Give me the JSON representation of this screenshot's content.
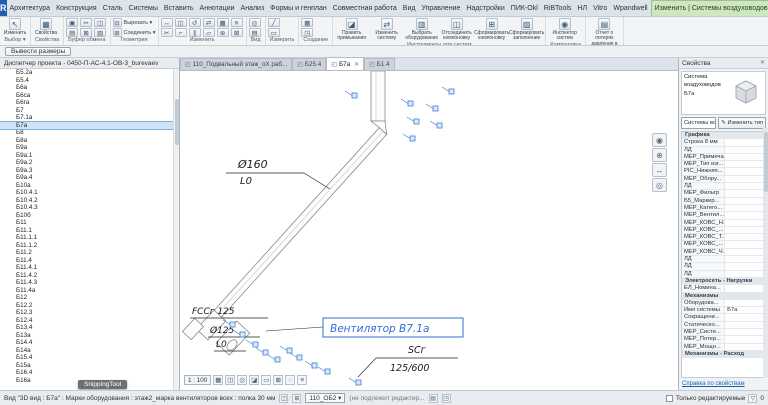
{
  "app": {
    "file_button": "R",
    "tabs": [
      "Архитектура",
      "Конструкция",
      "Сталь",
      "Системы",
      "Вставить",
      "Аннотации",
      "Анализ",
      "Формы и генплан",
      "Совместная работа",
      "Вид",
      "Управление",
      "Надстройки",
      "ПИК-Okl",
      "RiBTools",
      "НЛ",
      "Vitro",
      "Wpandwell"
    ],
    "context_tab": "Изменить | Системы воздуховодов",
    "ribbon_toggle_icon": "▾",
    "help_icon": "?"
  },
  "ribbon": {
    "options_button": "Вывести размеры",
    "groups": [
      {
        "label": "Выбор ▾",
        "type": "big",
        "buttons": [
          {
            "name": "modify-tool-button",
            "icon": "↖",
            "label": "Изменить"
          }
        ]
      },
      {
        "label": "Свойства",
        "type": "big",
        "buttons": [
          {
            "name": "properties-toggle-button",
            "icon": "▦",
            "label": "Свойства"
          }
        ]
      },
      {
        "label": "Буфер обмена",
        "type": "grid",
        "icons": [
          {
            "name": "paste-icon",
            "g": "▣"
          },
          {
            "name": "cut-icon",
            "g": "✂"
          },
          {
            "name": "copy-icon",
            "g": "◫"
          },
          {
            "name": "match-type-icon",
            "g": "▤"
          },
          {
            "name": "delete-icon",
            "g": "⊠"
          },
          {
            "name": "paint-icon",
            "g": "▧"
          }
        ]
      },
      {
        "label": "Геометрия",
        "type": "rows",
        "rows": [
          {
            "name": "cut-geometry-button",
            "icon": "⊟",
            "label": "Вырезать ▾"
          },
          {
            "name": "join-geometry-button",
            "icon": "⊞",
            "label": "Соединить ▾"
          }
        ]
      },
      {
        "label": "Изменить",
        "type": "grid",
        "icons": [
          {
            "name": "move-icon",
            "g": "↔"
          },
          {
            "name": "copy-element-icon",
            "g": "◫"
          },
          {
            "name": "rotate-icon",
            "g": "↺"
          },
          {
            "name": "mirror-icon",
            "g": "⇄"
          },
          {
            "name": "array-icon",
            "g": "▦"
          },
          {
            "name": "align-icon",
            "g": "≡"
          },
          {
            "name": "split-icon",
            "g": "✂"
          },
          {
            "name": "trim-icon",
            "g": "⌐"
          },
          {
            "name": "offset-icon",
            "g": "∥"
          },
          {
            "name": "scale-icon",
            "g": "▱"
          },
          {
            "name": "pin-icon",
            "g": "⊕"
          },
          {
            "name": "delete-element-icon",
            "g": "⊠"
          }
        ]
      },
      {
        "label": "Вид",
        "type": "grid",
        "icons": [
          {
            "name": "hide-element-icon",
            "g": "◎"
          },
          {
            "name": "visibility-icon",
            "g": "▤"
          }
        ]
      },
      {
        "label": "Измерить",
        "type": "grid",
        "icons": [
          {
            "name": "measure-icon",
            "g": "╱"
          },
          {
            "name": "dimension-icon",
            "g": "▭"
          }
        ]
      },
      {
        "label": "Создание",
        "type": "grid",
        "icons": [
          {
            "name": "create-group-icon",
            "g": "▦"
          },
          {
            "name": "create-similar-icon",
            "g": "◳"
          }
        ]
      },
      {
        "label": "Инструменты для систем",
        "type": "bigrow",
        "buttons": [
          {
            "name": "edit-adjoining-button",
            "icon": "◪",
            "label": "Править примыкания"
          },
          {
            "name": "edit-system-button",
            "icon": "⇄",
            "label": "Изменить систему"
          },
          {
            "name": "select-equipment-button",
            "icon": "▥",
            "label": "Выбрать оборудование"
          },
          {
            "name": "disconnect-layout-button",
            "icon": "◫",
            "label": "Отсоединить компоновку"
          },
          {
            "name": "generate-layout-button",
            "icon": "⊞",
            "label": "Сформировать компоновку"
          },
          {
            "name": "generate-placeholder-button",
            "icon": "▨",
            "label": "Сформировать заполнение"
          }
        ]
      },
      {
        "label": "Компоновка",
        "type": "bigrow",
        "buttons": [
          {
            "name": "system-inspector-button",
            "icon": "◉",
            "label": "Инспектор систем"
          }
        ]
      },
      {
        "label": "Анализ",
        "type": "bigrow",
        "buttons": [
          {
            "name": "pressure-loss-report-button",
            "icon": "▤",
            "label": "Отчет о потерях давления в воздуховоде"
          }
        ]
      }
    ]
  },
  "browser": {
    "title": "Диспетчер проекта - 0450-П-АС-4.1-ОВ-3_burevaev",
    "selected_index": 7,
    "items": [
      "Б5.2а",
      "Б5.4",
      "Б6а",
      "Б6са",
      "Б6га",
      "Б7",
      "Б7.1а",
      "Б7а",
      "Б8",
      "Б8а",
      "Б9а",
      "Б9а.1",
      "Б9а.2",
      "Б9а.3",
      "Б9а.4",
      "Б10а",
      "Б10.4.1",
      "Б10.4.2",
      "Б10.4.3",
      "Б10б",
      "Б11",
      "Б11.1",
      "Б11.1.1",
      "Б11.1.2",
      "Б11.2",
      "Б11.4",
      "Б11.4.1",
      "Б11.4.2",
      "Б11.4.3",
      "Б11.4а",
      "Б12",
      "Б12.2",
      "Б12.3",
      "Б12.4",
      "Б13.4",
      "Б13а",
      "Б14.4",
      "Б14а",
      "Б15.4",
      "Б15а",
      "Б16.4",
      "Б16а"
    ]
  },
  "view_tabs": [
    {
      "label": "110_Подвальный этаж_оХ раб...",
      "active": false
    },
    {
      "label": "Б25.4",
      "active": false
    },
    {
      "label": "Б7а",
      "active": true
    },
    {
      "label": "Б1.4",
      "active": false
    }
  ],
  "canvas": {
    "scale": "1 : 100",
    "labels": {
      "duct_dia": "Ø160",
      "duct_len": "L0",
      "fan_model": "FCCг 125",
      "fan_dia": "Ø125",
      "fan_len": "L0",
      "fan_name": "Вентилятор В7.1а",
      "grille_code": "SCг",
      "grille_size": "125/600"
    }
  },
  "properties": {
    "title": "Свойства",
    "type_family": "Система воздуховодов",
    "type_name": "Б7а",
    "selector_value": "Системы возду...",
    "edit_type_label": "Изменить тип",
    "help_link": "Справка по свойствам",
    "rows": [
      {
        "cat": "Графика"
      },
      {
        "name": "Строка 8 мм",
        "value": ""
      },
      {
        "name": "ЛД",
        "value": ""
      },
      {
        "name": "MEP_Примеча...",
        "value": ""
      },
      {
        "name": "MEP_Тип изг...",
        "value": ""
      },
      {
        "name": "РІС_Нижняя...",
        "value": ""
      },
      {
        "name": "MEP_Обору...",
        "value": ""
      },
      {
        "name": "ЛД",
        "value": ""
      },
      {
        "name": "MEP_Фильтр",
        "value": ""
      },
      {
        "name": "Б5_Маркир...",
        "value": ""
      },
      {
        "name": "MEP_Катего...",
        "value": ""
      },
      {
        "name": "MEP_Вентил...",
        "value": ""
      },
      {
        "name": "MEP_КОВС_Н...",
        "value": ""
      },
      {
        "name": "MEP_КОВС_...",
        "value": ""
      },
      {
        "name": "MEP_КОВС_Т...",
        "value": ""
      },
      {
        "name": "MEP_КОВС_...",
        "value": ""
      },
      {
        "name": "MEP_КОВС_Ч...",
        "value": ""
      },
      {
        "name": "ЛД",
        "value": ""
      },
      {
        "name": "ЛД",
        "value": ""
      },
      {
        "name": "ЛД",
        "value": ""
      },
      {
        "cat": "Электросеть - Нагрузки"
      },
      {
        "name": "ЕЛ_Номина...",
        "value": ""
      },
      {
        "cat": "Механизмы"
      },
      {
        "name": "Оборудова...",
        "value": ""
      },
      {
        "name": "Имя системы",
        "value": "Б7а"
      },
      {
        "name": "Сокращени...",
        "value": ""
      },
      {
        "name": "Статическо...",
        "value": ""
      },
      {
        "name": "MEP_Систе...",
        "value": ""
      },
      {
        "name": "MEP_Потер...",
        "value": ""
      },
      {
        "name": "MEP_Мощн...",
        "value": ""
      },
      {
        "cat": "Механизмы - Расход"
      }
    ]
  },
  "status_bar": {
    "view_info": "Вид \"3D вид : Б7а\" : Марки оборудования : этаж2_марка вентиляторов всех : полка 30 мм",
    "workset": "110_ОБ2",
    "workset_note": "(не подлежит редактир...",
    "editable_only_label": "Только редактируемые",
    "filter_count": "0"
  },
  "overlay": {
    "snip_tooltip": "SnippingTool"
  },
  "colors": {
    "selection_blue": "#3d7bd9",
    "annotation_blue": "#2f6fd6",
    "context_tab_green": "#cfe5c4"
  }
}
